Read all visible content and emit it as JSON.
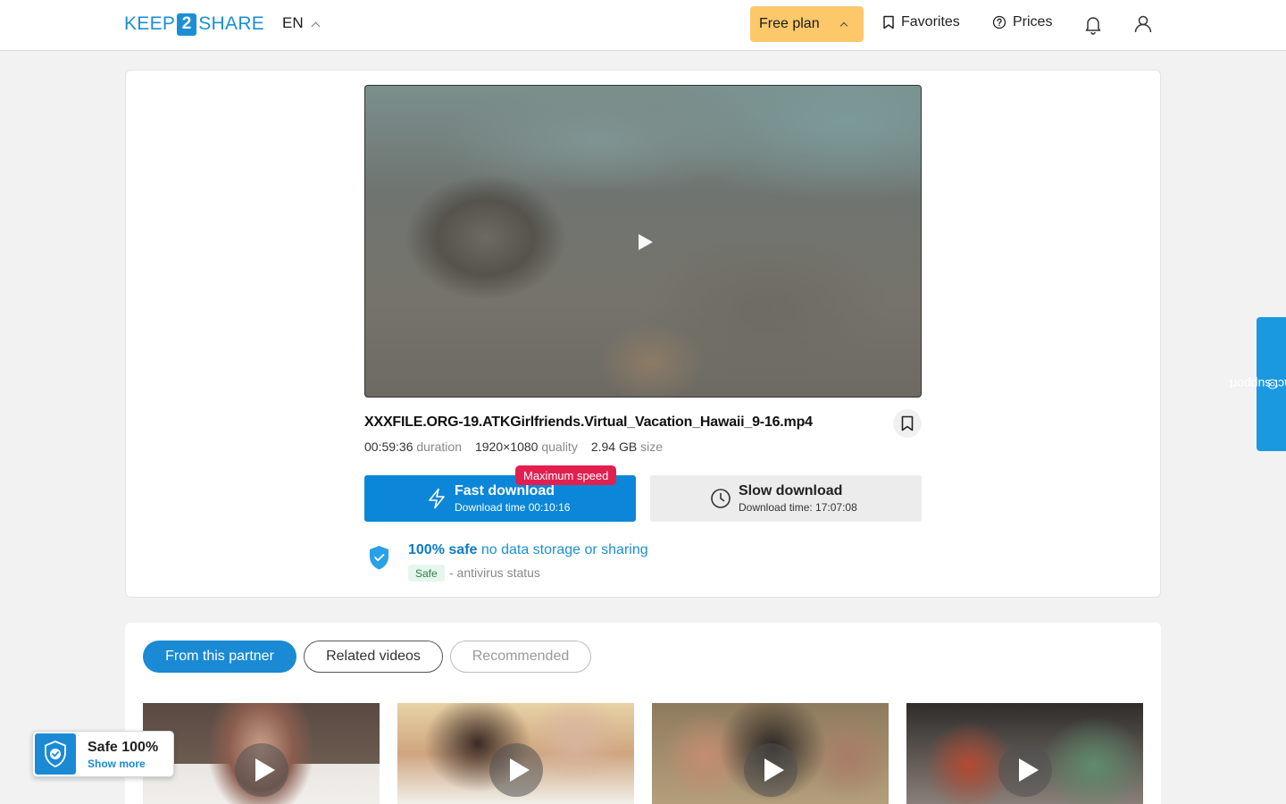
{
  "header": {
    "logo": {
      "part1": "KEEP",
      "part2": "2",
      "part3": "SHARE"
    },
    "language": "EN",
    "plan_label": "Free plan",
    "favorites_label": "Favorites",
    "prices_label": "Prices"
  },
  "file": {
    "name": "XXXFILE.ORG-19.ATKGirlfriends.Virtual_Vacation_Hawaii_9-16.mp4",
    "duration": "00:59:36",
    "duration_label": "duration",
    "quality": "1920×1080",
    "quality_label": "quality",
    "size": "2.94 GB",
    "size_label": "size"
  },
  "downloads": {
    "fast": {
      "title": "Fast download",
      "subtitle": "Download time 00:10:16",
      "badge": "Maximum speed"
    },
    "slow": {
      "title": "Slow download",
      "subtitle": "Download time: 17:07:08"
    }
  },
  "safety": {
    "bold": "100% safe",
    "text": "no data storage or sharing",
    "tag": "Safe",
    "status_text": "- antivirus status"
  },
  "support_label": "contact support",
  "tabs": [
    {
      "label": "From this partner",
      "active": true
    },
    {
      "label": "Related videos",
      "active": false
    },
    {
      "label": "Recommended",
      "active": false
    }
  ],
  "safe_widget": {
    "title": "Safe 100%",
    "link": "Show more"
  },
  "colors": {
    "accent": "#1a8ad4",
    "plan": "#fcc86a",
    "badge": "#e31f4f",
    "safe_tag_bg": "#e6f6ec"
  },
  "icons": [
    "bookmark-icon",
    "help-circle-icon",
    "bell-icon",
    "user-icon",
    "bolt-icon",
    "clock-icon",
    "shield-check-icon",
    "play-icon"
  ]
}
